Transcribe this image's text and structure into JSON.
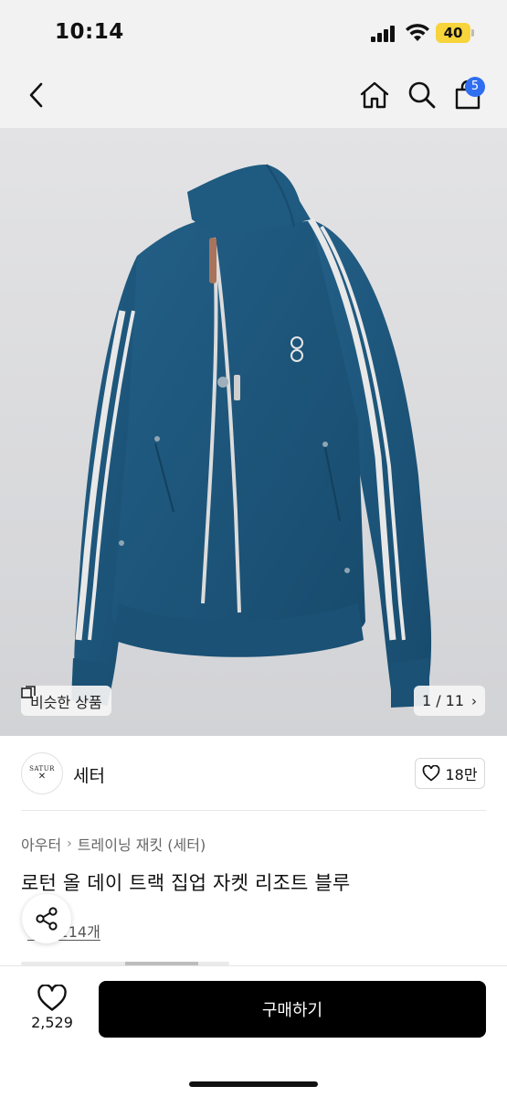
{
  "status_bar": {
    "time": "10:14",
    "battery": "40",
    "battery_color": "#f7d43b"
  },
  "nav": {
    "back_icon": "chevron-left-icon",
    "home_icon": "home-icon",
    "search_icon": "search-icon",
    "cart_icon": "shopping-bag-icon",
    "cart_count": "5",
    "badge_color": "#2f6ef0"
  },
  "gallery": {
    "similar_label": "비슷한 상품",
    "page_indicator": "1 / 11",
    "jacket_color": "#1d5a82"
  },
  "brand": {
    "logo_text": "SATUR",
    "name": "세터",
    "likes": "18만"
  },
  "product": {
    "category_parent": "아우터",
    "category_child": "트레이닝 재킷 (세터)",
    "title": "로턴 올 데이 트랙 집업 자켓 리조트 블루",
    "review_text": "후기 114개"
  },
  "bottom_bar": {
    "wish_count": "2,529",
    "buy_label": "구매하기"
  }
}
